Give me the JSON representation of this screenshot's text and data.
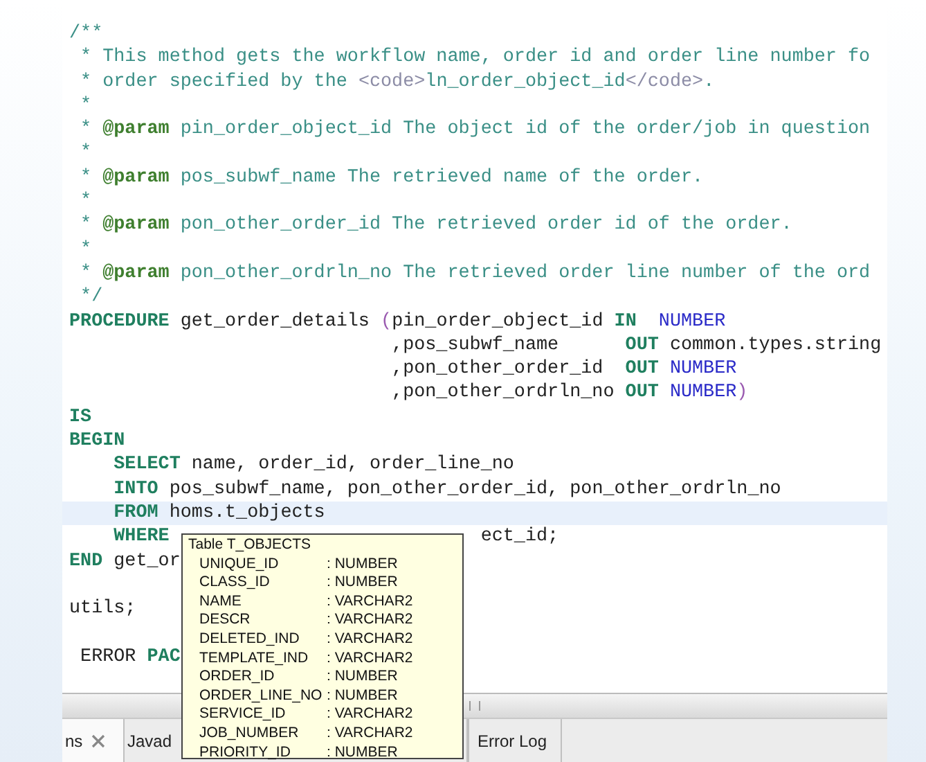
{
  "editor": {
    "lines": [
      {
        "highlighted": false,
        "segments": [
          {
            "kind": "comment",
            "text": "/**"
          }
        ]
      },
      {
        "highlighted": false,
        "segments": [
          {
            "kind": "comment",
            "text": " * This method gets the workflow name, order id and order line number fo"
          }
        ]
      },
      {
        "highlighted": false,
        "segments": [
          {
            "kind": "comment",
            "text": " * order specified by the "
          },
          {
            "kind": "tag",
            "text": "<code>"
          },
          {
            "kind": "comment",
            "text": "ln_order_object_id"
          },
          {
            "kind": "tag",
            "text": "</code>"
          },
          {
            "kind": "comment",
            "text": "."
          }
        ]
      },
      {
        "highlighted": false,
        "segments": [
          {
            "kind": "comment",
            "text": " *"
          }
        ]
      },
      {
        "highlighted": false,
        "segments": [
          {
            "kind": "comment",
            "text": " * "
          },
          {
            "kind": "doctag",
            "text": "@param"
          },
          {
            "kind": "comment",
            "text": " pin_order_object_id The object id of the order/job in question"
          }
        ]
      },
      {
        "highlighted": false,
        "segments": [
          {
            "kind": "comment",
            "text": " *"
          }
        ]
      },
      {
        "highlighted": false,
        "segments": [
          {
            "kind": "comment",
            "text": " * "
          },
          {
            "kind": "doctag",
            "text": "@param"
          },
          {
            "kind": "comment",
            "text": " pos_subwf_name The retrieved name of the order."
          }
        ]
      },
      {
        "highlighted": false,
        "segments": [
          {
            "kind": "comment",
            "text": " *"
          }
        ]
      },
      {
        "highlighted": false,
        "segments": [
          {
            "kind": "comment",
            "text": " * "
          },
          {
            "kind": "doctag",
            "text": "@param"
          },
          {
            "kind": "comment",
            "text": " pon_other_order_id The retrieved order id of the order."
          }
        ]
      },
      {
        "highlighted": false,
        "segments": [
          {
            "kind": "comment",
            "text": " *"
          }
        ]
      },
      {
        "highlighted": false,
        "segments": [
          {
            "kind": "comment",
            "text": " * "
          },
          {
            "kind": "doctag",
            "text": "@param"
          },
          {
            "kind": "comment",
            "text": " pon_other_ordrln_no The retrieved order line number of the ord"
          }
        ]
      },
      {
        "highlighted": false,
        "segments": [
          {
            "kind": "comment",
            "text": " */"
          }
        ]
      },
      {
        "highlighted": false,
        "segments": [
          {
            "kind": "keyword",
            "text": "PROCEDURE"
          },
          {
            "kind": "plain",
            "text": " get_order_details "
          },
          {
            "kind": "paren",
            "text": "("
          },
          {
            "kind": "plain",
            "text": "pin_order_object_id "
          },
          {
            "kind": "keyword",
            "text": "IN"
          },
          {
            "kind": "type",
            "text": "  NUMBER"
          }
        ]
      },
      {
        "highlighted": false,
        "segments": [
          {
            "kind": "plain",
            "text": "                             ,pos_subwf_name      "
          },
          {
            "kind": "keyword",
            "text": "OUT"
          },
          {
            "kind": "plain",
            "text": " common.types.string"
          }
        ]
      },
      {
        "highlighted": false,
        "segments": [
          {
            "kind": "plain",
            "text": "                             ,pon_other_order_id  "
          },
          {
            "kind": "keyword",
            "text": "OUT"
          },
          {
            "kind": "type",
            "text": " NUMBER"
          }
        ]
      },
      {
        "highlighted": false,
        "segments": [
          {
            "kind": "plain",
            "text": "                             ,pon_other_ordrln_no "
          },
          {
            "kind": "keyword",
            "text": "OUT"
          },
          {
            "kind": "type",
            "text": " NUMBER"
          },
          {
            "kind": "paren",
            "text": ")"
          }
        ]
      },
      {
        "highlighted": false,
        "segments": [
          {
            "kind": "keyword",
            "text": "IS"
          }
        ]
      },
      {
        "highlighted": false,
        "segments": [
          {
            "kind": "keyword",
            "text": "BEGIN"
          }
        ]
      },
      {
        "highlighted": false,
        "segments": [
          {
            "kind": "keyword",
            "text": "    SELECT"
          },
          {
            "kind": "plain",
            "text": " name, order_id, order_line_no"
          }
        ]
      },
      {
        "highlighted": false,
        "segments": [
          {
            "kind": "keyword",
            "text": "    INTO"
          },
          {
            "kind": "plain",
            "text": " pos_subwf_name, pon_other_order_id, pon_other_ordrln_no"
          }
        ]
      },
      {
        "highlighted": true,
        "segments": [
          {
            "kind": "keyword",
            "text": "    FROM"
          },
          {
            "kind": "plain",
            "text": " homs.t_objects"
          }
        ]
      },
      {
        "highlighted": false,
        "segments": [
          {
            "kind": "keyword",
            "text": "    WHERE"
          },
          {
            "kind": "plain",
            "text": "ect_id;",
            "covered_before": true
          }
        ]
      },
      {
        "highlighted": false,
        "segments": [
          {
            "kind": "keyword",
            "text": "END"
          },
          {
            "kind": "plain",
            "text": " get_or"
          }
        ]
      },
      {
        "highlighted": false
      },
      {
        "highlighted": false,
        "segments": [
          {
            "kind": "plain",
            "text": "utils;"
          }
        ]
      },
      {
        "highlighted": false
      },
      {
        "highlighted": false,
        "segments": [
          {
            "kind": "plain",
            "text": " ERROR "
          },
          {
            "kind": "keyword",
            "text": "PAC"
          }
        ]
      }
    ]
  },
  "tooltip": {
    "title": "Table T_OBJECTS",
    "columns": [
      {
        "name": "UNIQUE_ID",
        "type": ": NUMBER"
      },
      {
        "name": "CLASS_ID",
        "type": ": NUMBER"
      },
      {
        "name": "NAME",
        "type": ": VARCHAR2"
      },
      {
        "name": "DESCR",
        "type": ": VARCHAR2"
      },
      {
        "name": "DELETED_IND",
        "type": ": VARCHAR2"
      },
      {
        "name": "TEMPLATE_IND",
        "type": ": VARCHAR2"
      },
      {
        "name": "ORDER_ID",
        "type": ": NUMBER"
      },
      {
        "name": "ORDER_LINE_NO",
        "type": ": NUMBER"
      },
      {
        "name": "SERVICE_ID",
        "type": ": VARCHAR2"
      },
      {
        "name": "JOB_NUMBER",
        "type": ": VARCHAR2"
      },
      {
        "name": "PRIORITY_ID",
        "type": ": NUMBER"
      }
    ]
  },
  "bottom_tabs": [
    {
      "label": "ns",
      "selected": true,
      "closable": true
    },
    {
      "label": "Javad",
      "selected": false,
      "closable": false
    },
    {
      "label": "Error Log",
      "selected": false,
      "closable": false
    }
  ]
}
